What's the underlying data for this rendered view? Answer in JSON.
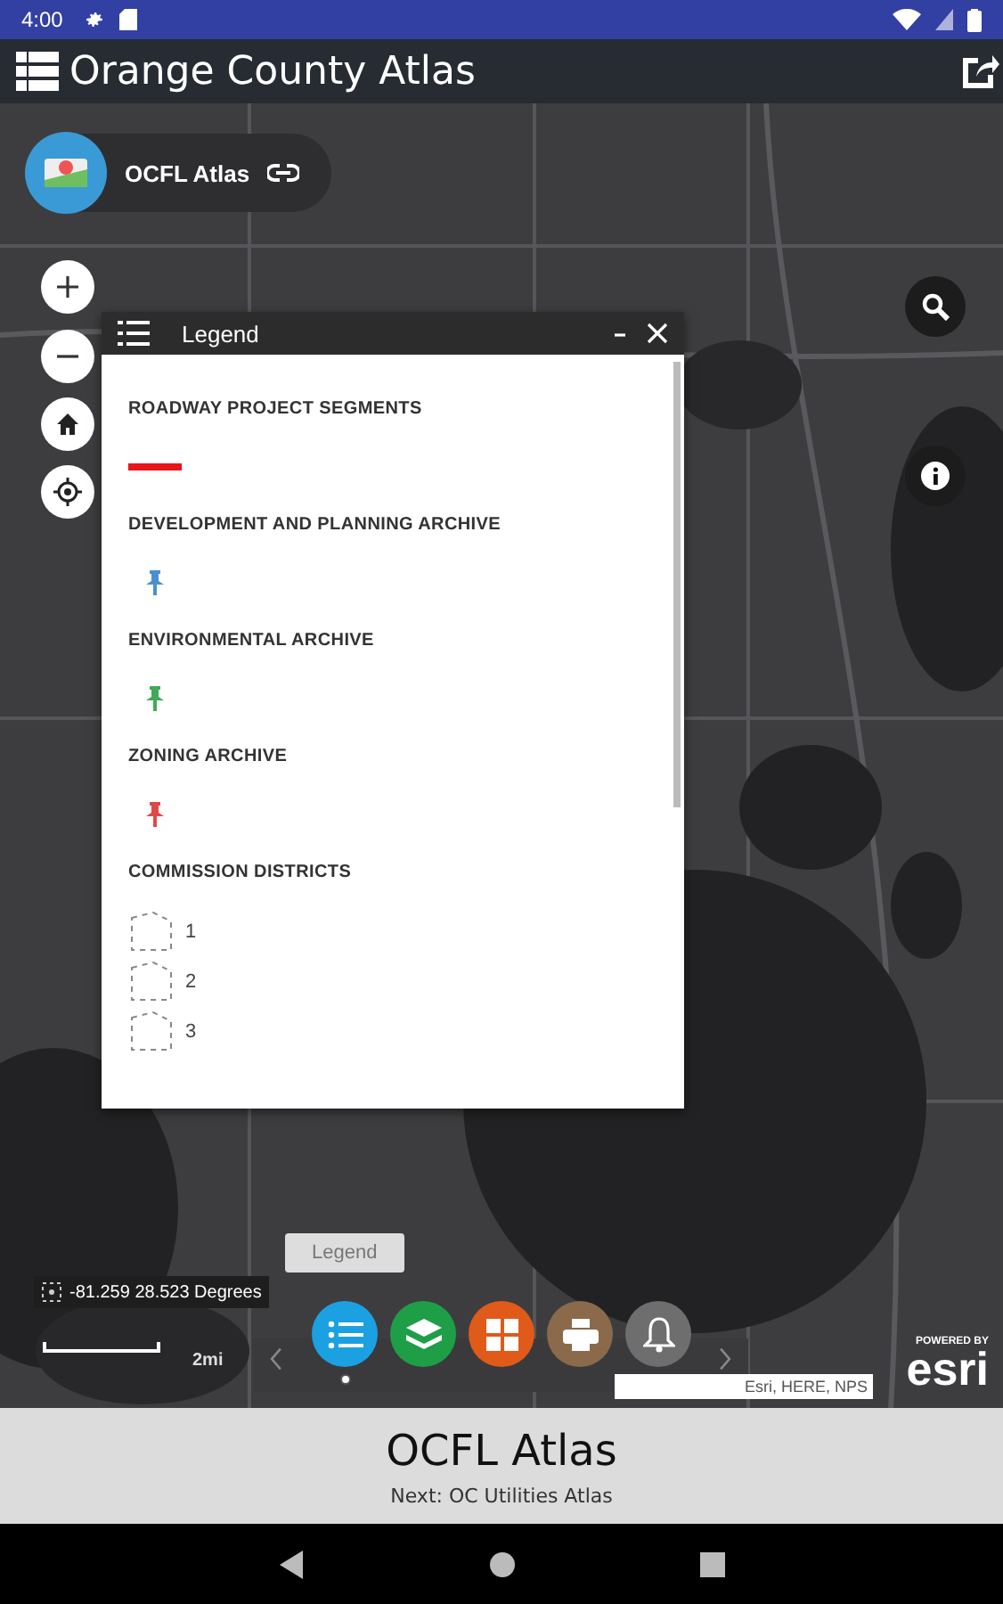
{
  "status_bar": {
    "time": "4:00"
  },
  "app_bar": {
    "title": "Orange County Atlas"
  },
  "app_chip": {
    "title": "OCFL Atlas"
  },
  "legend": {
    "title": "Legend",
    "sections": [
      {
        "title": "ROADWAY PROJECT SEGMENTS",
        "items": [
          {
            "kind": "line",
            "color": "#e8161b"
          }
        ]
      },
      {
        "title": "DEVELOPMENT AND PLANNING ARCHIVE",
        "items": [
          {
            "kind": "pin",
            "color": "#4a90d0"
          }
        ]
      },
      {
        "title": "ENVIRONMENTAL ARCHIVE",
        "items": [
          {
            "kind": "pin",
            "color": "#3faa5a"
          }
        ]
      },
      {
        "title": "ZONING ARCHIVE",
        "items": [
          {
            "kind": "pin",
            "color": "#e04848"
          }
        ]
      },
      {
        "title": "COMMISSION DISTRICTS",
        "items": [
          {
            "kind": "polygon",
            "label": "1"
          },
          {
            "kind": "polygon",
            "label": "2"
          },
          {
            "kind": "polygon",
            "label": "3"
          }
        ]
      }
    ]
  },
  "tooltip": "Legend",
  "coordinates": "-81.259 28.523 Degrees",
  "scale": "2mi",
  "toolbar": [
    {
      "kind": "legend",
      "color": "#1ba1e2",
      "selected": true
    },
    {
      "kind": "layers",
      "color": "#1f9e48",
      "selected": false
    },
    {
      "kind": "grid",
      "color": "#e05a1a",
      "selected": false
    },
    {
      "kind": "print",
      "color": "#8a6a4a",
      "selected": false
    },
    {
      "kind": "bell",
      "color": "#6e6e6e",
      "selected": false
    }
  ],
  "attribution": "Esri, HERE, NPS",
  "esri_logo": {
    "caption": "POWERED BY",
    "name": "esri"
  },
  "bottom_panel": {
    "title": "OCFL Atlas",
    "subtitle": "Next: OC Utilities Atlas"
  }
}
